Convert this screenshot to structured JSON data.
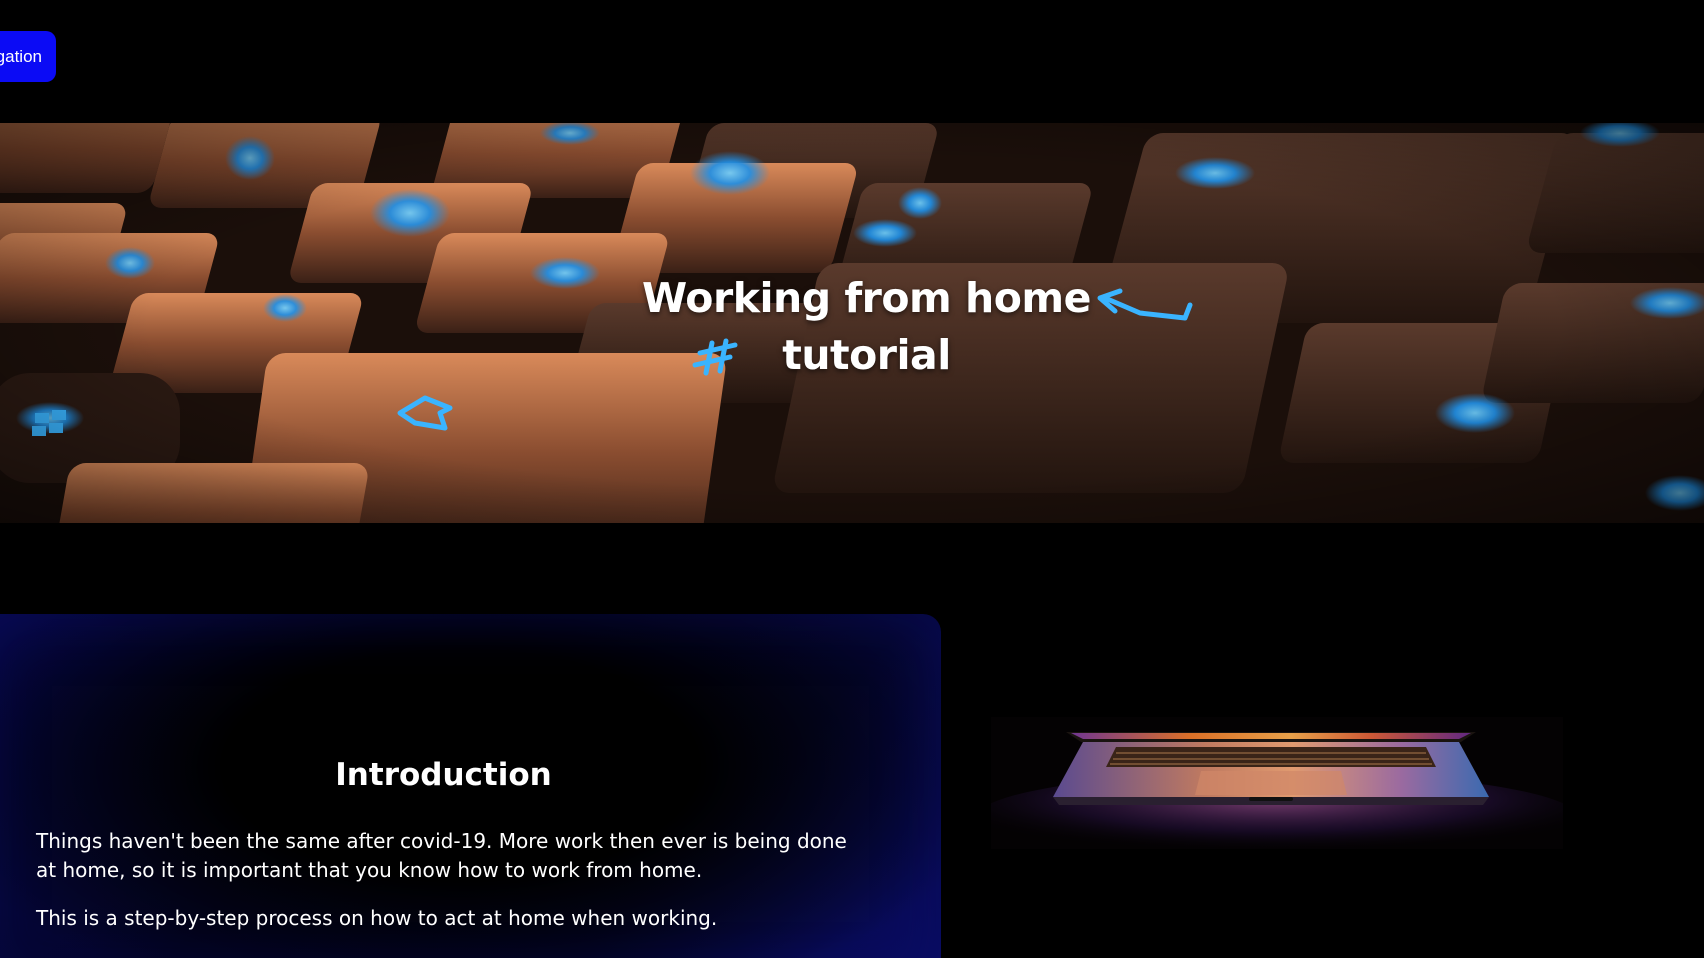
{
  "nav": {
    "toggle_label": "gation"
  },
  "hero": {
    "title_line1": "Working from home",
    "title_line2": "tutorial",
    "image_icon": "keyboard-photo"
  },
  "intro": {
    "title": "Introduction",
    "paragraph1": "Things haven't been the same after covid-19. More work then ever is being done at home, so it is important that you know how to work from home.",
    "paragraph2": "This is a step-by-step process on how to act at home when working."
  },
  "side_image": {
    "icon": "laptop-photo"
  },
  "colors": {
    "accent": "#0b0bf5",
    "background": "#000000",
    "card_glow": "#0a0d6a",
    "key_glow": "#3aa8ff"
  }
}
